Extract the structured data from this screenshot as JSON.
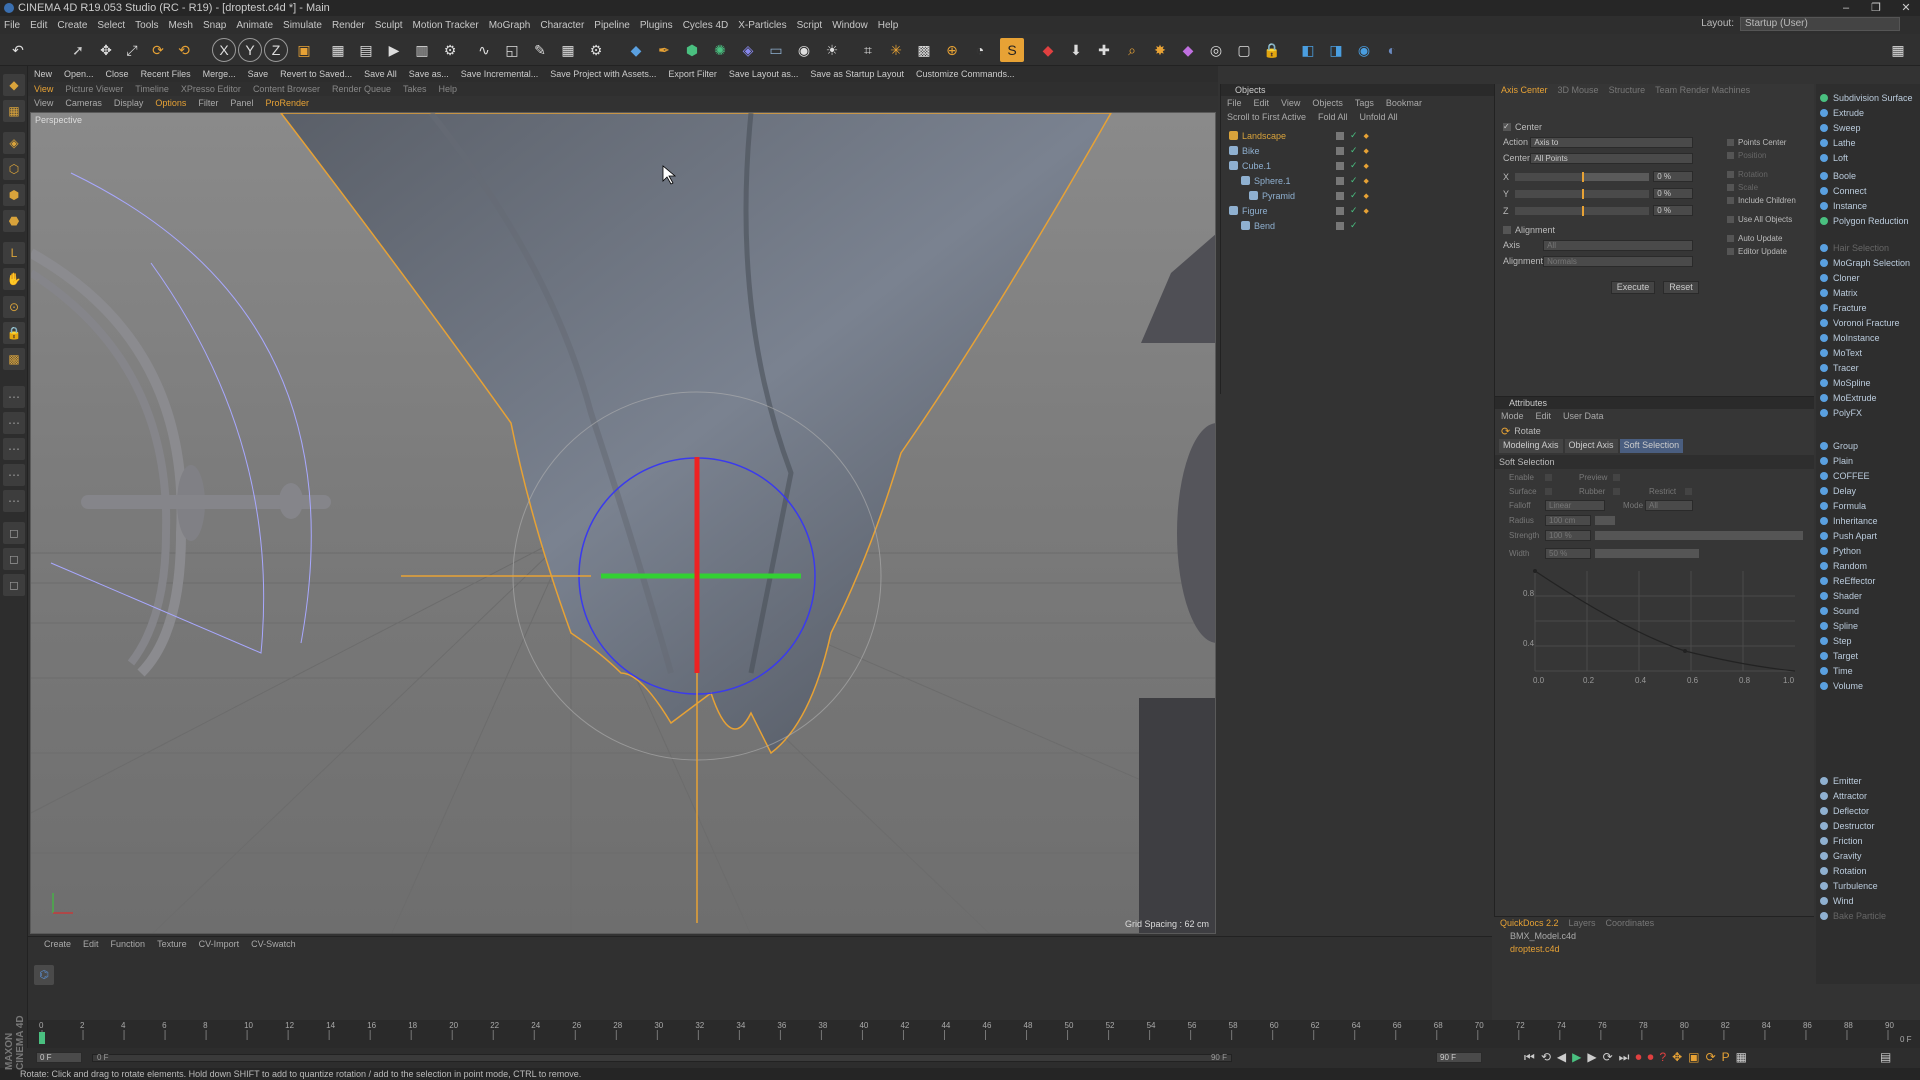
{
  "window": {
    "title": "CINEMA 4D R19.053 Studio (RC - R19) - [droptest.c4d *] - Main"
  },
  "menu": [
    "File",
    "Edit",
    "Create",
    "Select",
    "Tools",
    "Mesh",
    "Snap",
    "Animate",
    "Simulate",
    "Render",
    "Sculpt",
    "Motion Tracker",
    "MoGraph",
    "Character",
    "Pipeline",
    "Plugins",
    "Cycles 4D",
    "X-Particles",
    "Script",
    "Window",
    "Help"
  ],
  "layout": {
    "label": "Layout:",
    "value": "Startup (User)"
  },
  "command_bar": [
    "New",
    "Open...",
    "Close",
    "Recent Files",
    "Merge...",
    "Save",
    "Revert to Saved...",
    "Save All",
    "Save as...",
    "Save Incremental...",
    "Save Project with Assets...",
    "Export Filter",
    "Save Layout as...",
    "Save as Startup Layout",
    "Customize Commands..."
  ],
  "viewport_tabs": [
    "View",
    "Picture Viewer",
    "Timeline",
    "XPresso Editor",
    "Content Browser",
    "Render Queue",
    "Takes",
    "Help"
  ],
  "viewport_menu": [
    "View",
    "Cameras",
    "Display",
    "Options",
    "Filter",
    "Panel",
    "ProRender"
  ],
  "viewport": {
    "label": "Perspective",
    "grid_spacing": "Grid Spacing : 62 cm"
  },
  "objects": {
    "header": "Objects",
    "menu": [
      "File",
      "Edit",
      "View",
      "Objects",
      "Tags",
      "Bookmar"
    ],
    "toolbar": [
      "Scroll to First Active",
      "Fold All",
      "Unfold All"
    ],
    "items": [
      {
        "name": "Landscape",
        "color": "#d9a33b"
      },
      {
        "name": "Bike",
        "color": "#8fb0d0"
      },
      {
        "name": "Cube.1",
        "color": "#8fb0d0"
      },
      {
        "name": "Sphere.1",
        "color": "#8fb0d0"
      },
      {
        "name": "Pyramid",
        "color": "#8fb0d0"
      },
      {
        "name": "Figure",
        "color": "#8fb0d0"
      },
      {
        "name": "Bend",
        "color": "#8fb0d0"
      }
    ]
  },
  "axis_panel": {
    "tabs": [
      "Axis Center",
      "3D Mouse",
      "Structure",
      "Team Render Machines"
    ],
    "center_label": "Center",
    "action_label": "Action",
    "action_value": "Axis to",
    "center_sel_label": "Center",
    "center_sel_value": "All Points",
    "x_label": "X",
    "x_value": "0 %",
    "y_label": "Y",
    "y_value": "0 %",
    "z_label": "Z",
    "z_value": "0 %",
    "options": [
      "Points Center",
      "Position",
      "Rotation",
      "Scale",
      "Include Children",
      "Use All Objects",
      "Auto Update",
      "Editor Update"
    ],
    "alignment": "Alignment",
    "axis_label": "Axis",
    "axis_value": "All",
    "alignment_label": "Alignment",
    "alignment_value": "Normals",
    "execute": "Execute",
    "reset": "Reset"
  },
  "attributes": {
    "header": "Attributes",
    "menu": [
      "Mode",
      "Edit",
      "User Data"
    ],
    "tool": "Rotate",
    "tabs": [
      "Modeling Axis",
      "Object Axis",
      "Soft Selection"
    ],
    "section": "Soft Selection",
    "enable": "Enable",
    "preview": "Preview",
    "surface": "Surface",
    "rubber": "Rubber",
    "restrict": "Restrict",
    "falloff_label": "Falloff",
    "falloff_value": "Linear",
    "mode_label": "Mode",
    "mode_value": "All",
    "radius_label": "Radius",
    "radius_value": "100 cm",
    "strength_label": "Strength",
    "strength_value": "100 %",
    "width_label": "Width",
    "width_value": "50 %",
    "graph_y": [
      "0.8",
      "0.4"
    ],
    "graph_x": [
      "0.0",
      "0.2",
      "0.4",
      "0.6",
      "0.8",
      "1.0"
    ]
  },
  "right_palette": {
    "top": [
      "Subdivision Surface",
      "Extrude",
      "Sweep",
      "Lathe",
      "Loft",
      "Boole",
      "Connect",
      "Instance",
      "Polygon Reduction"
    ],
    "mograph": [
      "Hair Selection",
      "MoGraph Selection",
      "Cloner",
      "Matrix",
      "Fracture",
      "Voronoi Fracture",
      "MoInstance",
      "MoText",
      "Tracer",
      "MoSpline",
      "MoExtrude",
      "PolyFX"
    ],
    "effectors": [
      "Group",
      "Plain",
      "COFFEE",
      "Delay",
      "Formula",
      "Inheritance",
      "Push Apart",
      "Python",
      "Random",
      "ReEffector",
      "Shader",
      "Sound",
      "Spline",
      "Step",
      "Target",
      "Time",
      "Volume"
    ],
    "particles": [
      "Emitter",
      "Attractor",
      "Deflector",
      "Destructor",
      "Friction",
      "Gravity",
      "Rotation",
      "Turbulence",
      "Wind",
      "Bake Particle"
    ]
  },
  "bottom_menu": [
    "Create",
    "Edit",
    "Function",
    "Texture",
    "CV-Import",
    "CV-Swatch"
  ],
  "quickdocs": {
    "tabs": [
      "QuickDocs 2.2",
      "Layers",
      "Coordinates"
    ],
    "items": [
      "BMX_Model.c4d",
      "droptest.c4d"
    ]
  },
  "timeline": {
    "ticks": [
      "0",
      "2",
      "4",
      "6",
      "8",
      "10",
      "12",
      "14",
      "16",
      "18",
      "20",
      "22",
      "24",
      "26",
      "28",
      "30",
      "32",
      "34",
      "36",
      "38",
      "40",
      "42",
      "44",
      "46",
      "48",
      "50",
      "52",
      "54",
      "56",
      "58",
      "60",
      "62",
      "64",
      "66",
      "68",
      "70",
      "72",
      "74",
      "76",
      "78",
      "80",
      "82",
      "84",
      "86",
      "88",
      "90"
    ],
    "frame_end_label": "0 F"
  },
  "transport": {
    "start": "0 F",
    "current": "0 F",
    "end": "90 F",
    "end2": "90 F"
  },
  "status": "Rotate: Click and drag to rotate elements. Hold down SHIFT to add to quantize rotation / add to the selection in point mode, CTRL to remove.",
  "side_logo": "MAXON CINEMA 4D"
}
